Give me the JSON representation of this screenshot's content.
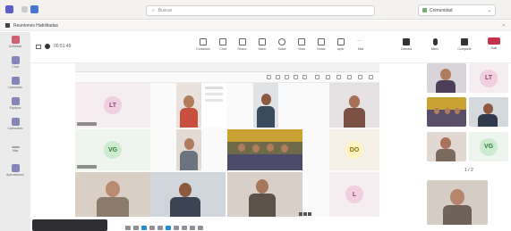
{
  "titlebar": {
    "search_placeholder": "Buscar",
    "org_name": "Comunidad"
  },
  "banner": {
    "text": "Reuniones Habilitadas"
  },
  "rail": {
    "items": [
      {
        "label": "Actividad",
        "icon": "bell-icon"
      },
      {
        "label": "Chat",
        "icon": "chat-icon"
      },
      {
        "label": "Llamadas",
        "icon": "phone-icon"
      },
      {
        "label": "Equipos",
        "icon": "teams-icon"
      },
      {
        "label": "Calendario",
        "icon": "calendar-icon"
      },
      {
        "label": "Más",
        "icon": "more-icon"
      },
      {
        "label": "Aplicaciones",
        "icon": "apps-icon"
      }
    ]
  },
  "meeting": {
    "timer": "00:51:49"
  },
  "toolbar": {
    "buttons": [
      {
        "label": "Contactos",
        "icon": "people-icon"
      },
      {
        "label": "Chat",
        "icon": "chat-icon"
      },
      {
        "label": "Reacc.",
        "icon": "reaction-icon"
      },
      {
        "label": "Mano",
        "icon": "hand-icon"
      },
      {
        "label": "Salas",
        "icon": "rooms-icon"
      },
      {
        "label": "Vista",
        "icon": "view-icon"
      },
      {
        "label": "Notas",
        "icon": "notes-icon"
      },
      {
        "label": "Aplic.",
        "icon": "apps-icon"
      },
      {
        "label": "Más",
        "icon": "more-icon"
      },
      {
        "label": "Cámara",
        "icon": "camera-icon"
      },
      {
        "label": "Micro",
        "icon": "mic-icon"
      },
      {
        "label": "Compartir",
        "icon": "share-icon"
      }
    ],
    "leave_label": "Salir"
  },
  "grid": {
    "initials": [
      "LT",
      "VG",
      "DO",
      "L"
    ]
  },
  "stage": {
    "initials": [
      "LT",
      "VG"
    ],
    "nav": "1 / 2"
  },
  "colors": {
    "accent": "#6264a7",
    "leave": "#c4314b",
    "avatar_pink": "#f0cfe0",
    "avatar_green": "#cdeccf",
    "avatar_yellow": "#fff3c4"
  }
}
